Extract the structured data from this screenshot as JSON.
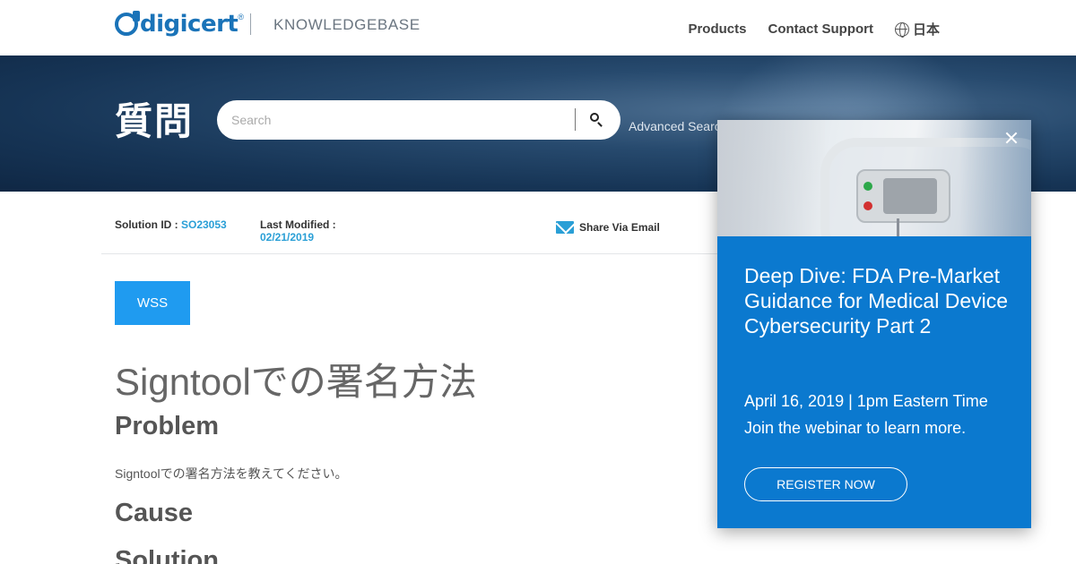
{
  "header": {
    "logo_text": "digicert",
    "logo_mark": "®",
    "section_label": "KNOWLEDGEBASE",
    "nav": [
      {
        "label": "Products"
      },
      {
        "label": "Contact Support"
      }
    ],
    "language_label": "日本"
  },
  "hero": {
    "heading": "質問",
    "search": {
      "placeholder": "Search"
    },
    "advanced_search_label": "Advanced Search"
  },
  "meta": {
    "solution_id_label": "Solution ID :",
    "solution_id_value": "SO23053",
    "last_modified_label": "Last Modified :",
    "last_modified_value": "02/21/2019",
    "share_label": "Share Via Email"
  },
  "article": {
    "tag": "WSS",
    "title": "Signtoolでの署名方法",
    "sections": [
      {
        "heading": "Problem",
        "body": "Signtoolでの署名方法を教えてください。"
      },
      {
        "heading": "Cause"
      },
      {
        "heading": "Solution"
      }
    ]
  },
  "popup": {
    "title": "Deep Dive: FDA Pre-Market Guidance for Medical Device Cybersecurity Part 2",
    "date": "April 16, 2019 | 1pm Eastern Time",
    "description": "Join the webinar to learn more.",
    "cta": "REGISTER NOW"
  },
  "colors": {
    "brand": "#1a73b8",
    "accent": "#2a9fd6",
    "tag_button": "#1f9bf0",
    "popup_bg": "#0b79cf"
  }
}
